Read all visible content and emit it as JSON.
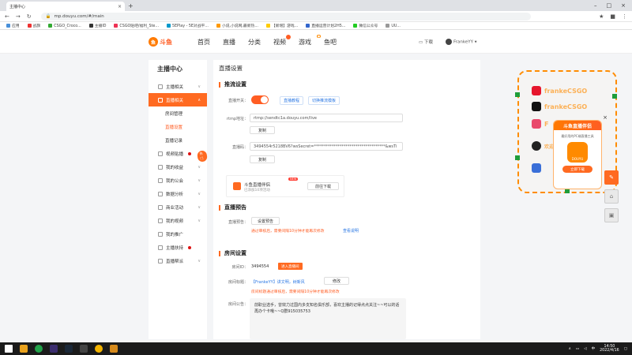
{
  "browser": {
    "tab_title": "主播中心",
    "url": "mp.douyu.com/#/main",
    "bookmarks": [
      "应用",
      "战旗",
      "CSGO_Croco...",
      "主播ID",
      "CSGO贴吧/福利_Ste...",
      "5EPlay - 5E对战平...",
      "小说,小说网,最新热...",
      "【新增】游戏...",
      "直播运营计划2H5...",
      "微信公众号",
      "UU..."
    ]
  },
  "site": {
    "logo_text": "斗鱼",
    "nav": [
      "首页",
      "直播",
      "分类",
      "视频",
      "游戏",
      "鱼吧"
    ],
    "download": "下载",
    "username": "FrankeYY"
  },
  "sidebar": {
    "title": "主播中心",
    "items": {
      "anchor_related": "主播相关",
      "live_related": "直播相关",
      "room_manage": "房间管理",
      "live_settings": "直播设置",
      "live_record": "直播记录",
      "video_upload": "视频贴播",
      "hot_badge": "热门",
      "my_income": "我的收益",
      "my_guild": "我的公会",
      "data_analysis": "数据分析",
      "business": "商业活动",
      "my_video": "我的视频",
      "my_promo": "我的推广",
      "anchor_support": "主播扶持",
      "live_helper": "直播帮派"
    }
  },
  "main": {
    "page_title": "直播设置",
    "stream": {
      "heading": "推流设置",
      "switch_label": "直播开关：",
      "live_link": "直播教程",
      "record_link": "切换推流模板",
      "rtmp_label": "rtmp地址：",
      "rtmp_value": "rtmp://sendtc1a.douyu.com/live",
      "copy": "复制",
      "code_label": "直播码：",
      "code_value": "3494554r5218BV6?wsSecret=************************************&wsTi",
      "copy2": "复制"
    },
    "companion": {
      "title": "斗鱼直播伴侣",
      "subtitle": "已添加10项活动",
      "new": "NEW",
      "button": "前往下载"
    },
    "preview": {
      "heading": "直播预告",
      "label": "直播预告：",
      "button": "设置预告",
      "warning": "通过审核后，需要间隔10分钟才能再次修改",
      "link": "查看说明"
    },
    "room": {
      "heading": "房间设置",
      "id_label": "房间ID：",
      "id_value": "3494554",
      "enter_button": "进入直播间",
      "title_label": "房间标题：",
      "title_value": "【FrankeYY】讲文明，树新风",
      "modify": "修改",
      "title_warning": "房间标题通过审核后，需要间隔10分钟才能再次修改",
      "notice_label": "房间公告：",
      "notice_text": "前职业选手，曾效力过国内多支知名俱乐部，喜欢主播的记得点点关注~~可以的话再办个卡哦~~Q群915035753"
    }
  },
  "overlay": {
    "row1": "frankeCSGO",
    "row2": "frankeCSGO",
    "row3": "F",
    "row4": "欢迎！群915035753",
    "popup_title": "斗鱼直播伴侣",
    "popup_sub": "最好用的PC端直播工具",
    "popup_app": "DOUYU",
    "popup_button": "立即下载",
    "close": "×"
  },
  "taskbar": {
    "time": "14:50",
    "date": "2022/4/16"
  }
}
